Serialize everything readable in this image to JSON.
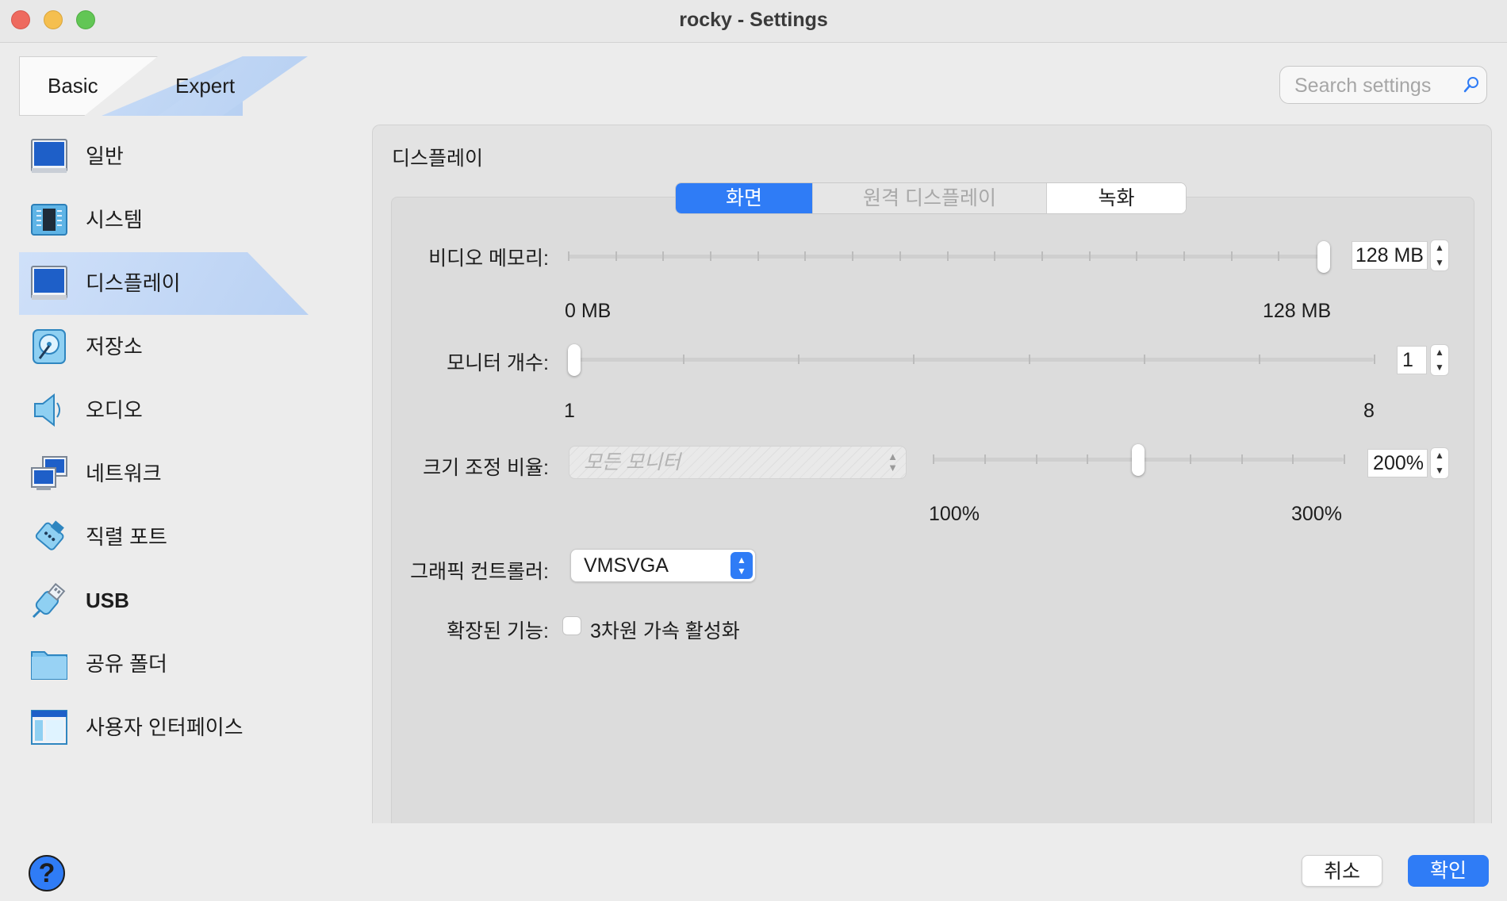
{
  "window": {
    "title": "rocky - Settings",
    "traffic_lights": [
      "close",
      "minimize",
      "zoom"
    ]
  },
  "mode_switch": {
    "basic": "Basic",
    "expert": "Expert",
    "selected": "Expert"
  },
  "search": {
    "placeholder": "Search settings",
    "value": ""
  },
  "sidebar": {
    "selected": "디스플레이",
    "items": [
      {
        "label": "일반",
        "icon": "general-icon"
      },
      {
        "label": "시스템",
        "icon": "system-chip-icon"
      },
      {
        "label": "디스플레이",
        "icon": "display-monitor-icon"
      },
      {
        "label": "저장소",
        "icon": "storage-disk-icon"
      },
      {
        "label": "오디오",
        "icon": "audio-speaker-icon"
      },
      {
        "label": "네트워크",
        "icon": "network-icon"
      },
      {
        "label": "직렬 포트",
        "icon": "serial-port-icon"
      },
      {
        "label": "USB",
        "icon": "usb-icon"
      },
      {
        "label": "공유 폴더",
        "icon": "shared-folder-icon"
      },
      {
        "label": "사용자 인터페이스",
        "icon": "user-interface-icon"
      }
    ]
  },
  "main": {
    "section_title": "디스플레이",
    "tabs": [
      {
        "label": "화면",
        "selected": true,
        "enabled": true
      },
      {
        "label": "원격 디스플레이",
        "selected": false,
        "enabled": false
      },
      {
        "label": "녹화",
        "selected": false,
        "enabled": true
      }
    ],
    "video_memory": {
      "label": "비디오 메모리:",
      "value": "128 MB",
      "min_label": "0 MB",
      "max_label": "128 MB",
      "slider_fraction": 1.0
    },
    "monitor_count": {
      "label": "모니터 개수:",
      "value": "1",
      "min_label": "1",
      "max_label": "8",
      "slider_fraction": 0.0
    },
    "scale_factor": {
      "label": "크기 조정 비율:",
      "monitor_select": "모든 모니터",
      "value": "200%",
      "min_label": "100%",
      "max_label": "300%",
      "slider_fraction": 0.5
    },
    "graphics_controller": {
      "label": "그래픽 컨트롤러:",
      "value": "VMSVGA"
    },
    "extended_features": {
      "label": "확장된 기능:",
      "checkbox_label": "3차원 가속 활성화",
      "checked": false
    }
  },
  "footer": {
    "help": "?",
    "cancel": "취소",
    "ok": "확인"
  },
  "colors": {
    "accent": "#2f7cf6",
    "selection": "#c4d9f6",
    "window_bg": "#ececec"
  }
}
